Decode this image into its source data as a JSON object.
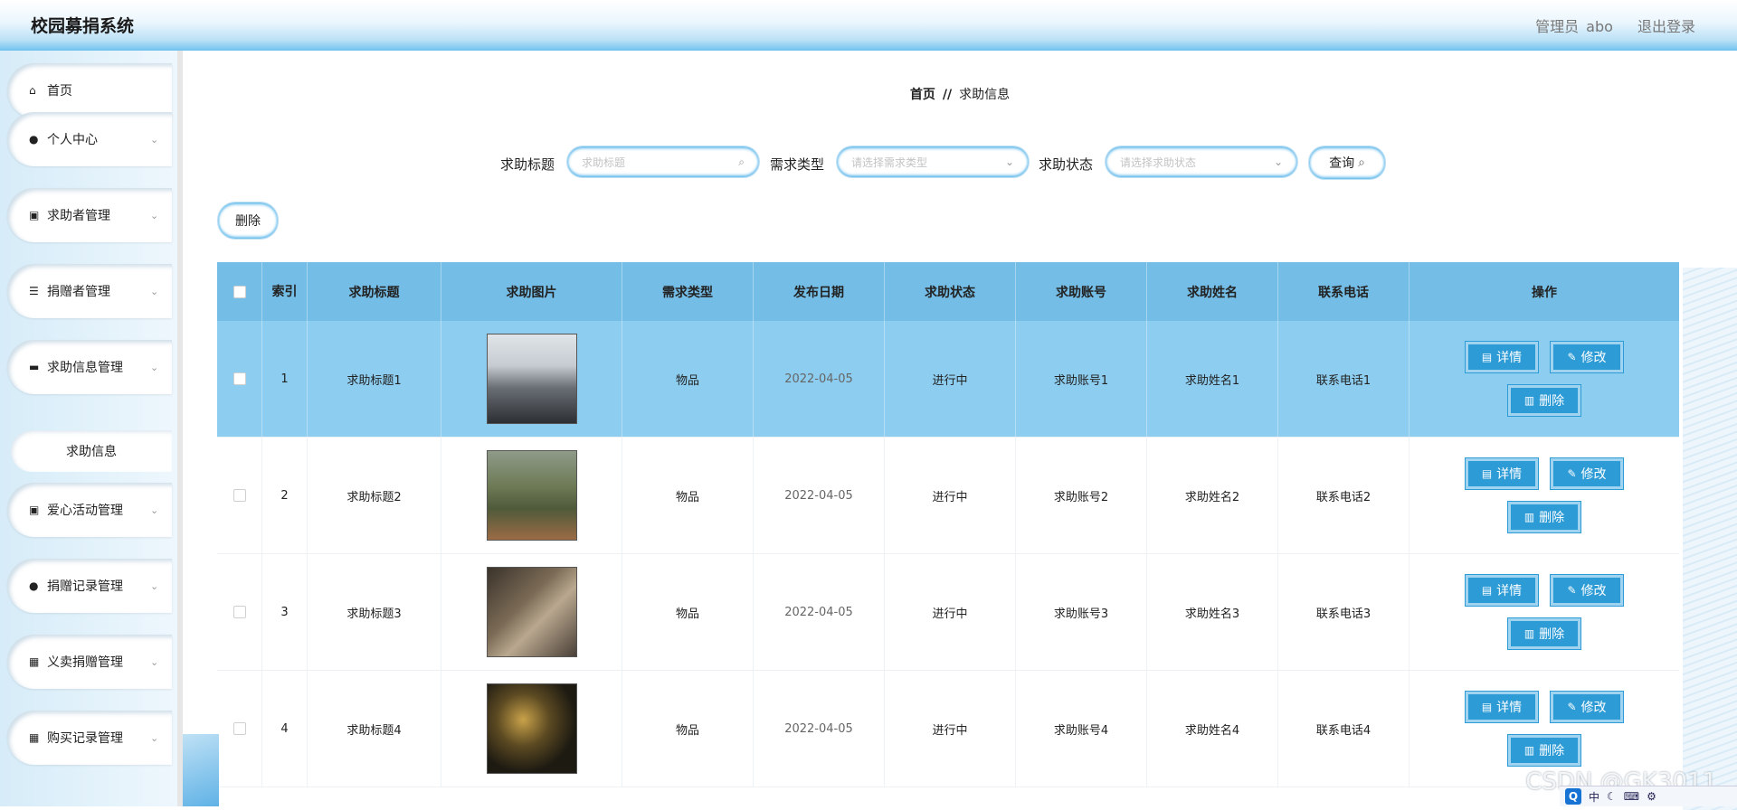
{
  "header": {
    "title": "校园募捐系统",
    "user_role": "管理员",
    "username": "abo",
    "logout": "退出登录"
  },
  "sidebar": {
    "items": [
      {
        "label": "首页",
        "icon": "home-icon",
        "glyph": "⌂"
      },
      {
        "label": "个人中心",
        "icon": "user-icon",
        "glyph": "●"
      },
      {
        "label": "求助者管理",
        "icon": "clipboard-icon",
        "glyph": "▣"
      },
      {
        "label": "捐赠者管理",
        "icon": "list-icon",
        "glyph": "☰"
      },
      {
        "label": "求助信息管理",
        "icon": "message-icon",
        "glyph": "▬"
      },
      {
        "label": "爱心活动管理",
        "icon": "clipboard-icon",
        "glyph": "▣"
      },
      {
        "label": "捐赠记录管理",
        "icon": "user-icon",
        "glyph": "●"
      },
      {
        "label": "义卖捐赠管理",
        "icon": "grid-icon",
        "glyph": "▦"
      },
      {
        "label": "购买记录管理",
        "icon": "grid-icon",
        "glyph": "▦"
      }
    ],
    "sub_item": "求助信息"
  },
  "breadcrumb": {
    "home": "首页",
    "separator": "//",
    "current": "求助信息"
  },
  "search": {
    "title_label": "求助标题",
    "title_placeholder": "求助标题",
    "type_label": "需求类型",
    "type_placeholder": "请选择需求类型",
    "status_label": "求助状态",
    "status_placeholder": "请选择求助状态",
    "query_button": "查询"
  },
  "toolbar": {
    "delete_label": "删除"
  },
  "table": {
    "columns": [
      "索引",
      "求助标题",
      "求助图片",
      "需求类型",
      "发布日期",
      "求助状态",
      "求助账号",
      "求助姓名",
      "联系电话",
      "操作"
    ],
    "rows": [
      {
        "index": "1",
        "title": "求助标题1",
        "type": "物品",
        "date": "2022-04-05",
        "status": "进行中",
        "account": "求助账号1",
        "name": "求助姓名1",
        "phone": "联系电话1"
      },
      {
        "index": "2",
        "title": "求助标题2",
        "type": "物品",
        "date": "2022-04-05",
        "status": "进行中",
        "account": "求助账号2",
        "name": "求助姓名2",
        "phone": "联系电话2"
      },
      {
        "index": "3",
        "title": "求助标题3",
        "type": "物品",
        "date": "2022-04-05",
        "status": "进行中",
        "account": "求助账号3",
        "name": "求助姓名3",
        "phone": "联系电话3"
      },
      {
        "index": "4",
        "title": "求助标题4",
        "type": "物品",
        "date": "2022-04-05",
        "status": "进行中",
        "account": "求助账号4",
        "name": "求助姓名4",
        "phone": "联系电话4"
      }
    ],
    "actions": {
      "detail": "详情",
      "edit": "修改",
      "delete": "删除"
    }
  },
  "watermark": "CSDN @GK3011",
  "tray": {
    "ime": "中"
  },
  "colors": {
    "header_bottom": "#6fc1ee",
    "table_header": "#74bde6",
    "selected_row": "#8dcdef",
    "action_button": "#2c9bd6"
  }
}
